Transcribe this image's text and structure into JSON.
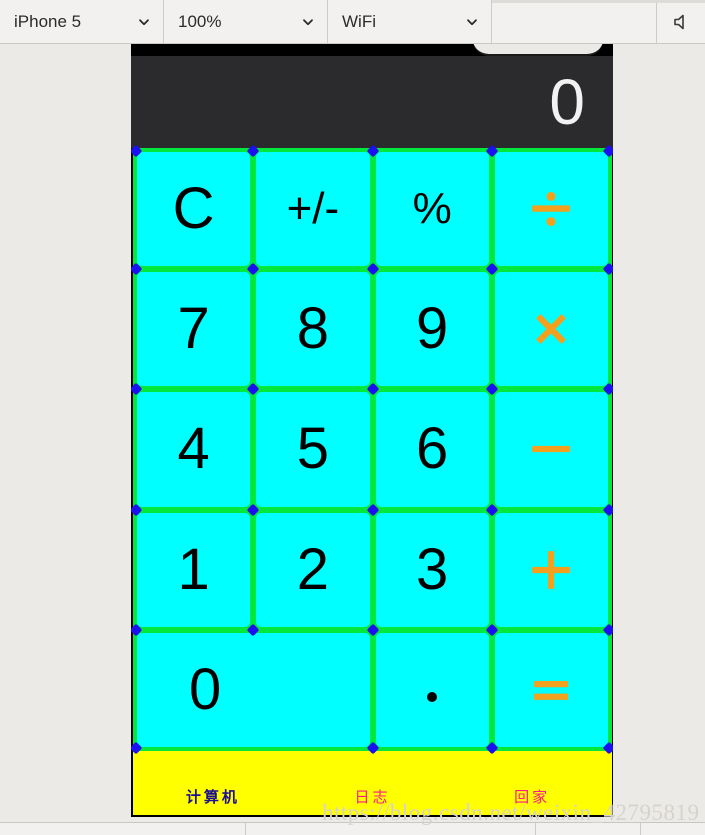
{
  "toolbar": {
    "device": {
      "value": "iPhone 5",
      "icon": "chevron-down-icon"
    },
    "zoom": {
      "value": "100%",
      "icon": "chevron-down-icon"
    },
    "network": {
      "value": "WiFi",
      "icon": "chevron-down-icon"
    },
    "speaker_icon": "speaker-icon"
  },
  "calculator": {
    "display_value": "0",
    "keys": [
      {
        "label": "C",
        "type": "function",
        "name": "key-clear"
      },
      {
        "label": "+/-",
        "type": "function",
        "name": "key-sign"
      },
      {
        "label": "%",
        "type": "function",
        "name": "key-percent"
      },
      {
        "label": "÷",
        "type": "operator",
        "name": "key-divide"
      },
      {
        "label": "7",
        "type": "digit",
        "name": "key-7"
      },
      {
        "label": "8",
        "type": "digit",
        "name": "key-8"
      },
      {
        "label": "9",
        "type": "digit",
        "name": "key-9"
      },
      {
        "label": "×",
        "type": "operator",
        "name": "key-multiply"
      },
      {
        "label": "4",
        "type": "digit",
        "name": "key-4"
      },
      {
        "label": "5",
        "type": "digit",
        "name": "key-5"
      },
      {
        "label": "6",
        "type": "digit",
        "name": "key-6"
      },
      {
        "label": "−",
        "type": "operator",
        "name": "key-minus"
      },
      {
        "label": "1",
        "type": "digit",
        "name": "key-1"
      },
      {
        "label": "2",
        "type": "digit",
        "name": "key-2"
      },
      {
        "label": "3",
        "type": "digit",
        "name": "key-3"
      },
      {
        "label": "+",
        "type": "operator",
        "name": "key-plus"
      },
      {
        "label": "0",
        "type": "digit-wide",
        "name": "key-0"
      },
      {
        "label": ".",
        "type": "digit",
        "name": "key-dot"
      },
      {
        "label": "=",
        "type": "operator",
        "name": "key-equals"
      }
    ]
  },
  "tabbar": {
    "items": [
      {
        "label": "计算机",
        "name": "tab-calculator",
        "active": true
      },
      {
        "label": "日志",
        "name": "tab-log",
        "active": false
      },
      {
        "label": "回家",
        "name": "tab-home",
        "active": false
      }
    ]
  },
  "watermark": {
    "text": "https://blog.csdn.net/weixin_42795819"
  },
  "bottombar": {
    "cells": [
      "",
      "",
      "",
      ""
    ]
  },
  "colors": {
    "key_fill": "#00ffff",
    "key_border": "#00e83c",
    "operator_text": "#f2a01e",
    "digit_text": "#000000",
    "display_bg": "#2b2a2c",
    "display_text": "#f2f2f2",
    "tabbar_bg": "#ffff00",
    "tab_active": "#1b0f8f",
    "tab_inactive": "#ff1a8c",
    "handle": "#1b10ef"
  }
}
